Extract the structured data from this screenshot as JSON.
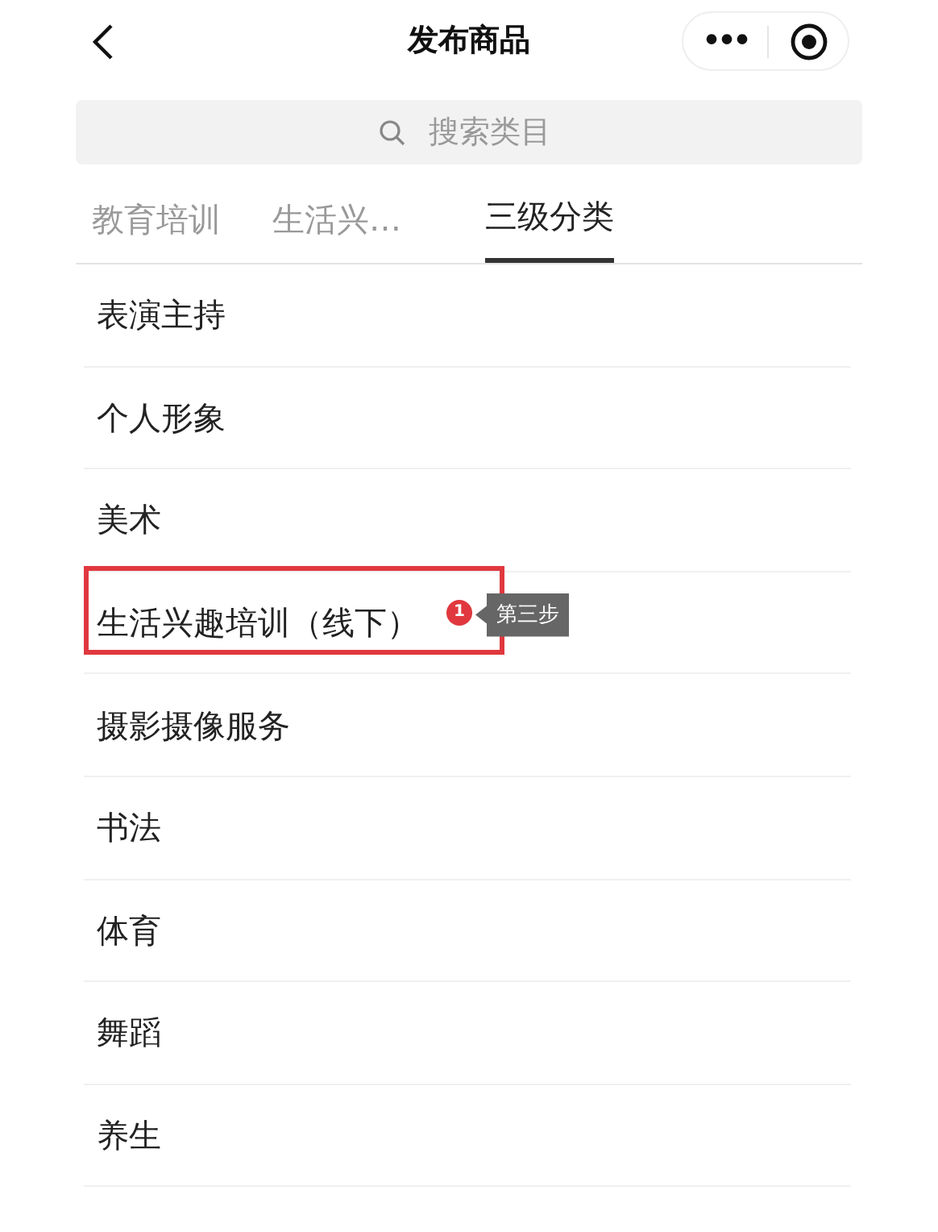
{
  "header": {
    "title": "发布商品",
    "more": "•••"
  },
  "search": {
    "placeholder": "搜索类目"
  },
  "tabs": [
    {
      "label": "教育培训",
      "selected": false
    },
    {
      "label": "生活兴…",
      "selected": false
    },
    {
      "label": "三级分类",
      "selected": true
    }
  ],
  "items": [
    {
      "label": "表演主持",
      "highlighted": false
    },
    {
      "label": "个人形象",
      "highlighted": false
    },
    {
      "label": "美术",
      "highlighted": false
    },
    {
      "label": "生活兴趣培训（线下）",
      "highlighted": true,
      "badge": "1",
      "tooltip": "第三步"
    },
    {
      "label": "摄影摄像服务",
      "highlighted": false
    },
    {
      "label": "书法",
      "highlighted": false
    },
    {
      "label": "体育",
      "highlighted": false
    },
    {
      "label": "舞蹈",
      "highlighted": false
    },
    {
      "label": "养生",
      "highlighted": false
    }
  ]
}
